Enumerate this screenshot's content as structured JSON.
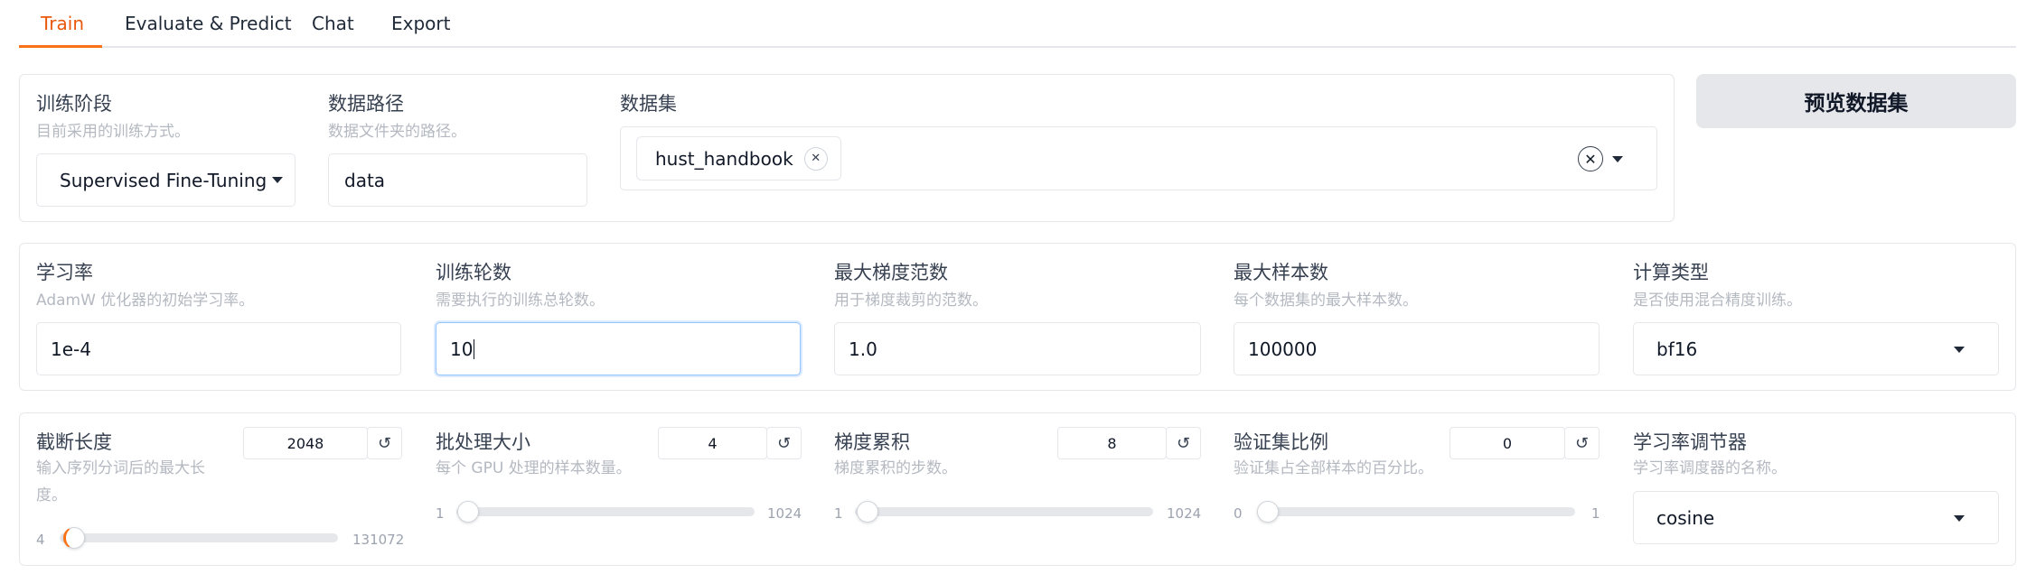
{
  "tabs": [
    {
      "label": "Train",
      "active": true
    },
    {
      "label": "Evaluate & Predict",
      "active": false
    },
    {
      "label": "Chat",
      "active": false
    },
    {
      "label": "Export",
      "active": false
    }
  ],
  "accent_color": "#f97316",
  "row1": {
    "stage": {
      "label": "训练阶段",
      "info": "目前采用的训练方式。",
      "value": "Supervised Fine-Tuning"
    },
    "data_path": {
      "label": "数据路径",
      "info": "数据文件夹的路径。",
      "value": "data"
    },
    "dataset": {
      "label": "数据集",
      "selected": [
        "hust_handbook"
      ]
    },
    "preview_button": "预览数据集"
  },
  "row2": {
    "learning_rate": {
      "label": "学习率",
      "info": "AdamW 优化器的初始学习率。",
      "value": "1e-4"
    },
    "epochs": {
      "label": "训练轮数",
      "info": "需要执行的训练总轮数。",
      "value": "10"
    },
    "max_grad_norm": {
      "label": "最大梯度范数",
      "info": "用于梯度裁剪的范数。",
      "value": "1.0"
    },
    "max_samples": {
      "label": "最大样本数",
      "info": "每个数据集的最大样本数。",
      "value": "100000"
    },
    "compute_type": {
      "label": "计算类型",
      "info": "是否使用混合精度训练。",
      "value": "bf16"
    }
  },
  "row3": {
    "cutoff_len": {
      "label": "截断长度",
      "info_line1": "输入序列分词后的最大长",
      "info_line2": "度。",
      "value": "2048",
      "min": "4",
      "max": "131072",
      "fraction": 0.0156
    },
    "batch_size": {
      "label": "批处理大小",
      "info": "每个 GPU 处理的样本数量。",
      "value": "4",
      "min": "1",
      "max": "1024",
      "fraction": 0.003
    },
    "grad_accum": {
      "label": "梯度累积",
      "info": "梯度累积的步数。",
      "value": "8",
      "min": "1",
      "max": "1024",
      "fraction": 0.007
    },
    "val_size": {
      "label": "验证集比例",
      "info": "验证集占全部样本的百分比。",
      "value": "0",
      "min": "0",
      "max": "1",
      "fraction": 0.0
    },
    "lr_scheduler": {
      "label": "学习率调节器",
      "info": "学习率调度器的名称。",
      "value": "cosine"
    }
  }
}
